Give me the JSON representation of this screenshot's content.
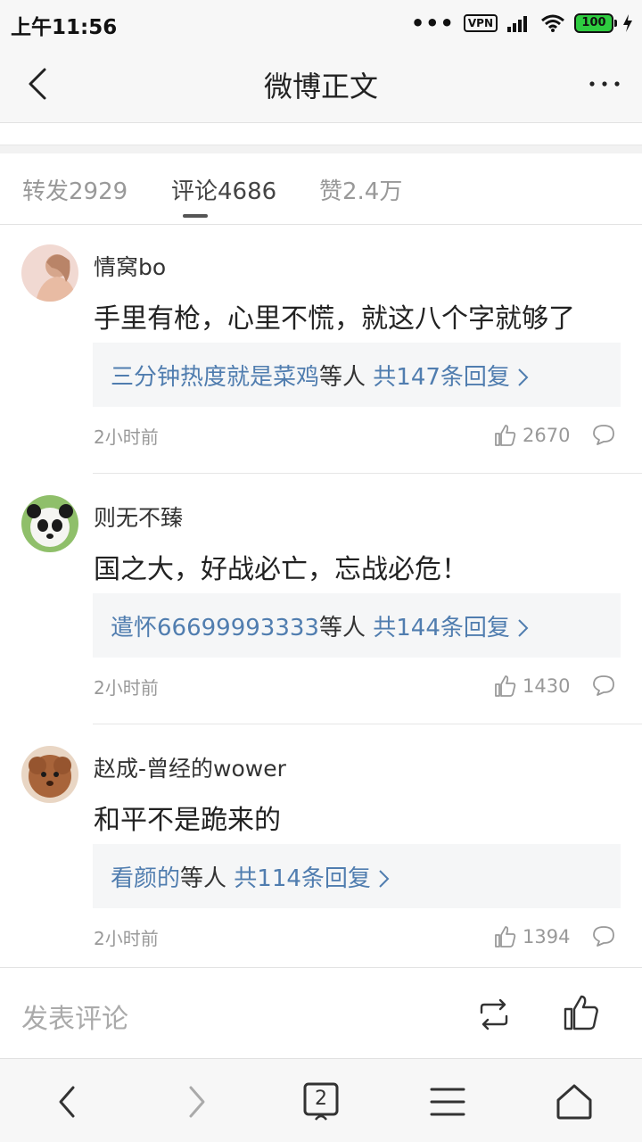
{
  "status_bar": {
    "time": "上午11:56",
    "vpn_label": "VPN",
    "battery_level": "100"
  },
  "nav": {
    "title": "微博正文",
    "back_icon": "chevron-left-icon",
    "more_icon": "more-horizontal-icon"
  },
  "tabs": [
    {
      "label": "转发2929",
      "active": false
    },
    {
      "label": "评论4686",
      "active": true
    },
    {
      "label": "赞2.4万",
      "active": false
    }
  ],
  "comments": [
    {
      "username": "情窝bo",
      "content": "手里有枪，心里不慌，就这八个字就够了",
      "reply_user": "三分钟热度就是菜鸡",
      "reply_mid": "等人",
      "reply_count": "共147条回复",
      "time": "2小时前",
      "likes": "2670"
    },
    {
      "username": "则无不臻",
      "content": "国之大，好战必亡，忘战必危！",
      "reply_user": "遣怀66699993333",
      "reply_mid": "等人",
      "reply_count": "共144条回复",
      "time": "2小时前",
      "likes": "1430"
    },
    {
      "username": "赵成-曾经的wower",
      "content": "和平不是跪来的",
      "reply_user": "看颜的",
      "reply_mid": "等人",
      "reply_count": "共114条回复",
      "time": "2小时前",
      "likes": "1394"
    }
  ],
  "comment_bar": {
    "placeholder": "发表评论"
  },
  "browser": {
    "tab_count": "2"
  },
  "colors": {
    "link": "#507daf",
    "battery": "#2ecc40"
  }
}
